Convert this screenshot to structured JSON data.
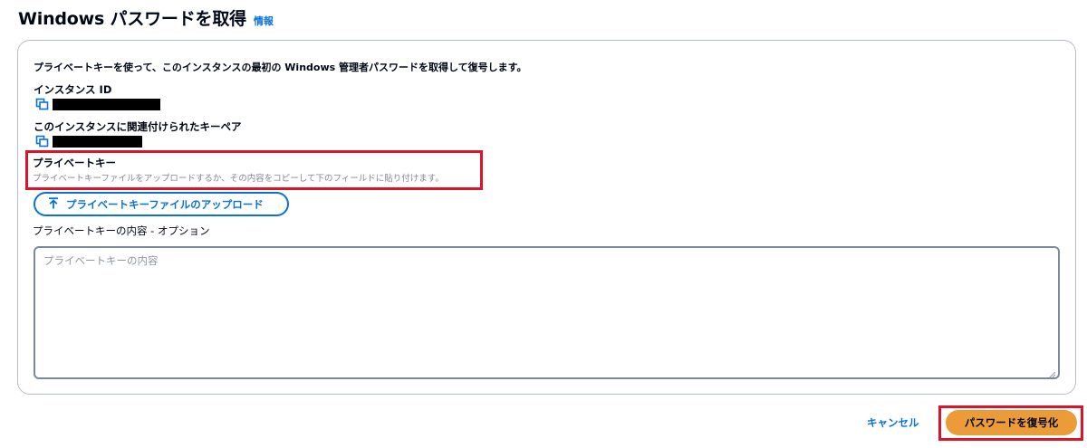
{
  "header": {
    "title": "Windows パスワードを取得",
    "info_link": "情報"
  },
  "panel": {
    "description": "プライベートキーを使って、このインスタンスの最初の Windows 管理者パスワードを取得して復号します。",
    "instance_id_label": "インスタンス ID",
    "key_pair_label": "このインスタンスに関連付けられたキーペア",
    "private_key": {
      "title": "プライベートキー",
      "subtitle": "プライベートキーファイルをアップロードするか、その内容をコピーして下のフィールドに貼り付けます。"
    },
    "upload_button_label": "プライベートキーファイルのアップロード",
    "content_label": "プライベートキーの内容 - オプション",
    "content_placeholder": "プライベートキーの内容"
  },
  "footer": {
    "cancel_label": "キャンセル",
    "decrypt_label": "パスワードを復号化"
  },
  "colors": {
    "link": "#0972d3",
    "primary_button": "#ec9b39",
    "highlight": "#d9142b",
    "redaction": "#000000"
  },
  "icons": {
    "copy": "copy-icon",
    "upload": "upload-icon",
    "resize": "resize-grip-icon"
  }
}
